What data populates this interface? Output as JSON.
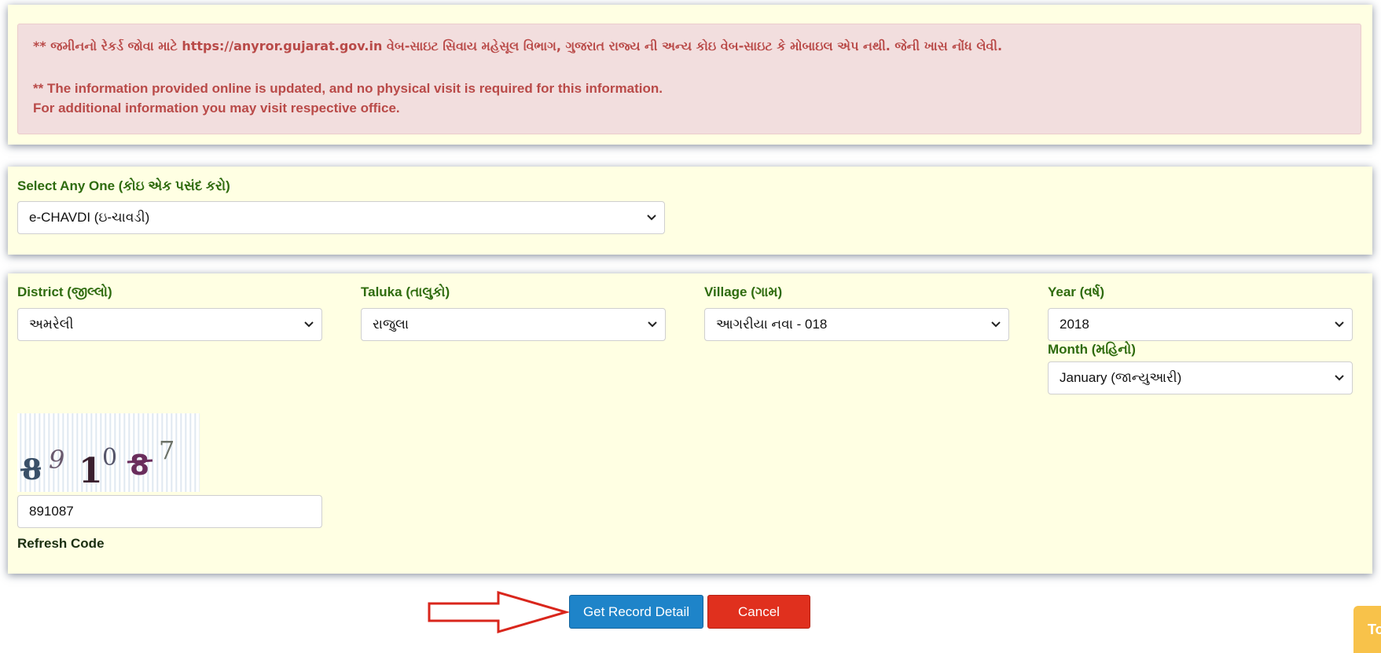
{
  "notice": {
    "gujarati_line": "** જમીનનો રેકર્ડ જોવા માટે https://anyror.gujarat.gov.in વેબ-સાઇટ સિવાય મહેસૂલ વિભાગ, ગુજરાત રાજ્ય ની અન્ય કોઇ વેબ-સાઇટ કે મોબાઇલ એપ નથી. જેની ખાસ નોંધ લેવી.",
    "english_line1": "** The information provided online is updated, and no physical visit is required for this information.",
    "english_line2": "For additional information you may visit respective office."
  },
  "selector": {
    "label": "Select Any One (કોઇ એક પસંદ કરો)",
    "value": "e-CHAVDI (ઇ-ચાવડી)"
  },
  "form": {
    "district": {
      "label": "District (જીલ્લો)",
      "value": "અમરેલી"
    },
    "taluka": {
      "label": "Taluka (તાલુકો)",
      "value": "રાજુલા"
    },
    "village": {
      "label": "Village (ગામ)",
      "value": "આગરીયા નવા - 018"
    },
    "year": {
      "label": "Year (વર્ષ)",
      "value": "2018"
    },
    "month": {
      "label": "Month (મહિનો)",
      "value": "January (જાન્યુઆરી)"
    },
    "captcha": {
      "digits": [
        "8",
        "9",
        "1",
        "0",
        "8",
        "7"
      ]
    },
    "captcha_input": "891087",
    "refresh_label": "Refresh Code"
  },
  "buttons": {
    "get_record": "Get Record Detail",
    "cancel": "Cancel"
  },
  "corner_tab": "To",
  "colors": {
    "panel_bg": "#ffffe3",
    "alert_bg": "#f2dede",
    "alert_text": "#b94a48",
    "label_green": "#2e6b0e",
    "primary_button": "#1e84c9",
    "cancel_button": "#e0301e",
    "arrow_red": "#d9261c"
  }
}
